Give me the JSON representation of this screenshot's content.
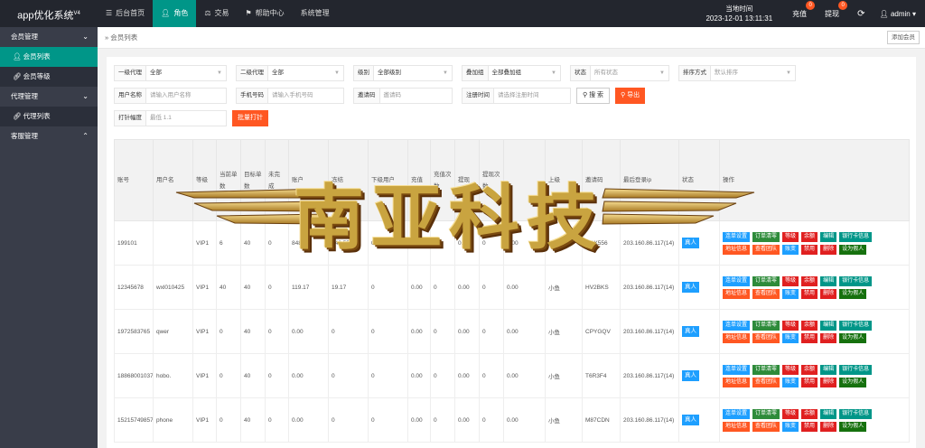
{
  "app": {
    "title": "app优化系统",
    "version": "V4"
  },
  "nav": [
    {
      "label": "后台首页",
      "icon": "menu-icon"
    },
    {
      "label": "角色",
      "icon": "user-icon",
      "active": true
    },
    {
      "label": "交易",
      "icon": "scale-icon"
    },
    {
      "label": "帮助中心",
      "icon": "flag-icon"
    },
    {
      "label": "系统管理",
      "icon": ""
    }
  ],
  "header": {
    "time_label": "当地时间",
    "time_value": "2023-12-01 13:11:31",
    "recharge": {
      "label": "充值",
      "badge": "0"
    },
    "withdraw": {
      "label": "提现",
      "badge": "0"
    },
    "username": "admin"
  },
  "sidebar": {
    "groups": [
      {
        "label": "会员管理",
        "items": [
          {
            "label": "会员列表",
            "active": true
          },
          {
            "label": "会员等级"
          }
        ]
      },
      {
        "label": "代理管理",
        "items": [
          {
            "label": "代理列表"
          }
        ]
      },
      {
        "label": "客服管理",
        "items": []
      }
    ]
  },
  "breadcrumb": "会员列表",
  "add_member_label": "添加会员",
  "filters": {
    "level1": {
      "label": "一级代理",
      "value": "全部"
    },
    "level2": {
      "label": "二级代理",
      "value": "全部"
    },
    "grade": {
      "label": "级别",
      "value": "全部级别"
    },
    "boost": {
      "label": "叠加组",
      "value": "全部叠加组"
    },
    "status": {
      "label": "状态",
      "value": "所有状态"
    },
    "sort": {
      "label": "排序方式",
      "value": "默认排序"
    },
    "username": {
      "label": "用户名称",
      "placeholder": "请输入用户名称"
    },
    "phone": {
      "label": "手机号码",
      "placeholder": "请输入手机号码"
    },
    "invite": {
      "label": "邀请码",
      "placeholder": "邀请码"
    },
    "regtime": {
      "label": "注册时间",
      "placeholder": "请选择注册时间"
    },
    "search_label": "搜 索",
    "export_label": "导出",
    "punch": {
      "label": "打针幅度",
      "placeholder": "最低 1.1"
    },
    "batch_label": "批量打针"
  },
  "table": {
    "headers": [
      "账号",
      "用户名",
      "等级",
      "当前单数",
      "目标单数",
      "未完成",
      "账户",
      "冻结",
      "下级用户",
      "充值",
      "充值次数",
      "提现",
      "提现次数",
      "",
      "上级",
      "邀请码",
      "最后登录ip",
      "状态",
      "操作"
    ],
    "rows": [
      {
        "account": "199101",
        "username": "",
        "level": "VIP1",
        "cur": "6",
        "target": "40",
        "undone": "0",
        "balance": "848.80",
        "frozen": "142.55",
        "sub": "0",
        "recharge": "0.00",
        "rc": "0",
        "withdraw": "0.00",
        "wc": "0",
        "x": "0.00",
        "parent": "小鱼",
        "code": "XOX556",
        "ip": "203.160.86.117(14)",
        "status": "真人"
      },
      {
        "account": "12345678",
        "username": "wxl010425",
        "level": "VIP1",
        "cur": "40",
        "target": "40",
        "undone": "0",
        "balance": "119.17",
        "frozen": "19.17",
        "sub": "0",
        "recharge": "0.00",
        "rc": "0",
        "withdraw": "0.00",
        "wc": "0",
        "x": "0.00",
        "parent": "小鱼",
        "code": "HV2BKS",
        "ip": "203.160.86.117(14)",
        "status": "真人"
      },
      {
        "account": "1972583765",
        "username": "qwer",
        "level": "VIP1",
        "cur": "0",
        "target": "40",
        "undone": "0",
        "balance": "0.00",
        "frozen": "0",
        "sub": "0",
        "recharge": "0.00",
        "rc": "0",
        "withdraw": "0.00",
        "wc": "0",
        "x": "0.00",
        "parent": "小鱼",
        "code": "CPYGQV",
        "ip": "203.160.86.117(14)",
        "status": "真人"
      },
      {
        "account": "18868001037",
        "username": "hobo.",
        "level": "VIP1",
        "cur": "0",
        "target": "40",
        "undone": "0",
        "balance": "0.00",
        "frozen": "0",
        "sub": "0",
        "recharge": "0.00",
        "rc": "0",
        "withdraw": "0.00",
        "wc": "0",
        "x": "0.00",
        "parent": "小鱼",
        "code": "T6R3F4",
        "ip": "203.160.86.117(14)",
        "status": "真人"
      },
      {
        "account": "15215749857",
        "username": "phone",
        "level": "VIP1",
        "cur": "0",
        "target": "40",
        "undone": "0",
        "balance": "0.00",
        "frozen": "0",
        "sub": "0",
        "recharge": "0.00",
        "rc": "0",
        "withdraw": "0.00",
        "wc": "0",
        "x": "0.00",
        "parent": "小鱼",
        "code": "M87CDN",
        "ip": "203.160.86.117(14)",
        "status": "真人"
      }
    ],
    "actions": [
      {
        "label": "连单设置",
        "color": "#1e9fff"
      },
      {
        "label": "订单清零",
        "color": "#2e8b3a"
      },
      {
        "label": "等级",
        "color": "#e02020"
      },
      {
        "label": "余额",
        "color": "#e02020"
      },
      {
        "label": "编辑",
        "color": "#009688"
      },
      {
        "label": "银行卡信息",
        "color": "#009688"
      },
      {
        "label": "地址信息",
        "color": "#ff5722"
      },
      {
        "label": "查看团队",
        "color": "#ff5722"
      },
      {
        "label": "账变",
        "color": "#1e9fff"
      },
      {
        "label": "禁用",
        "color": "#e02020"
      },
      {
        "label": "删除",
        "color": "#e02020"
      },
      {
        "label": "设为假人",
        "color": "#16710e"
      }
    ]
  },
  "watermark": "南亚科技"
}
